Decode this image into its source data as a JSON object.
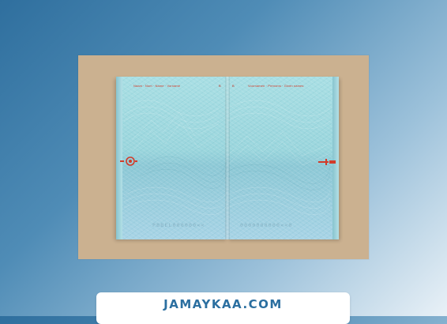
{
  "photo": {
    "left_header": "Naam · Nom · Name · Vorname",
    "right_header": "Voornamen · Prénoms · Given names",
    "left_page_mark": "B",
    "right_page_mark": "B",
    "left_mrz": "PBBEL000000<<",
    "right_mrz": "0000000000<<0"
  },
  "caption": {
    "text": "JAMAYKAA.COM"
  },
  "colors": {
    "accent": "#2b6fa0",
    "security_red": "#d23b2a",
    "page_tint": "#9bd6dd",
    "backdrop": "#cbb190"
  }
}
